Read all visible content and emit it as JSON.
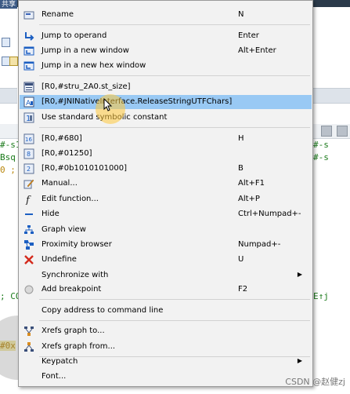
{
  "background": {
    "top_tab": "共享",
    "code_lines": [
      "#-s1",
      "Bsq",
      "0 ;",
      "#-s",
      "#-s",
      "; CO",
      "E↑j",
      "#0x"
    ]
  },
  "menu": {
    "items": [
      {
        "label": "Rename",
        "shortcut": "N",
        "icon": "rename-icon"
      },
      {
        "label": "Jump to operand",
        "shortcut": "Enter",
        "icon": "jump-arrow-icon"
      },
      {
        "label": "Jump in a new window",
        "shortcut": "Alt+Enter",
        "icon": "new-window-icon"
      },
      {
        "label": "Jump in a new hex window",
        "shortcut": "",
        "icon": "hex-window-icon"
      },
      {
        "label": "[R0,#stru_2A0.st_size]",
        "shortcut": "",
        "icon": "struct-offset-icon"
      },
      {
        "label": "[R0,#JNINativeInterface.ReleaseStringUTFChars]",
        "shortcut": "",
        "icon": "struct-offset-selected-icon"
      },
      {
        "label": "Use standard symbolic constant",
        "shortcut": "",
        "icon": "symbolic-constant-icon"
      },
      {
        "label": "[R0,#680]",
        "shortcut": "H",
        "icon": "hex-number-icon"
      },
      {
        "label": "[R0,#01250]",
        "shortcut": "",
        "icon": "octal-number-icon"
      },
      {
        "label": "[R0,#0b1010101000]",
        "shortcut": "B",
        "icon": "binary-number-icon"
      },
      {
        "label": "Manual...",
        "shortcut": "Alt+F1",
        "icon": "manual-edit-icon"
      },
      {
        "label": "Edit function...",
        "shortcut": "Alt+P",
        "icon": "function-icon"
      },
      {
        "label": "Hide",
        "shortcut": "Ctrl+Numpad+-",
        "icon": "hide-icon"
      },
      {
        "label": "Graph view",
        "shortcut": "",
        "icon": "graph-view-icon"
      },
      {
        "label": "Proximity browser",
        "shortcut": "Numpad+-",
        "icon": "proximity-icon"
      },
      {
        "label": "Undefine",
        "shortcut": "U",
        "icon": "undefine-x-icon"
      },
      {
        "label": "Synchronize with",
        "shortcut": "",
        "icon": "",
        "submenu": true
      },
      {
        "label": "Add breakpoint",
        "shortcut": "F2",
        "icon": "breakpoint-icon"
      },
      {
        "label": "Copy address to command line",
        "shortcut": "",
        "icon": ""
      },
      {
        "label": "Xrefs graph to...",
        "shortcut": "",
        "icon": "xrefs-to-icon"
      },
      {
        "label": "Xrefs graph from...",
        "shortcut": "",
        "icon": "xrefs-from-icon"
      },
      {
        "label": "Keypatch",
        "shortcut": "",
        "icon": "",
        "submenu": true
      },
      {
        "label": "Font...",
        "shortcut": "",
        "icon": ""
      }
    ],
    "submenu_arrow": "▶",
    "selected_index": 5
  },
  "watermark": "CSDN @赵健zj"
}
